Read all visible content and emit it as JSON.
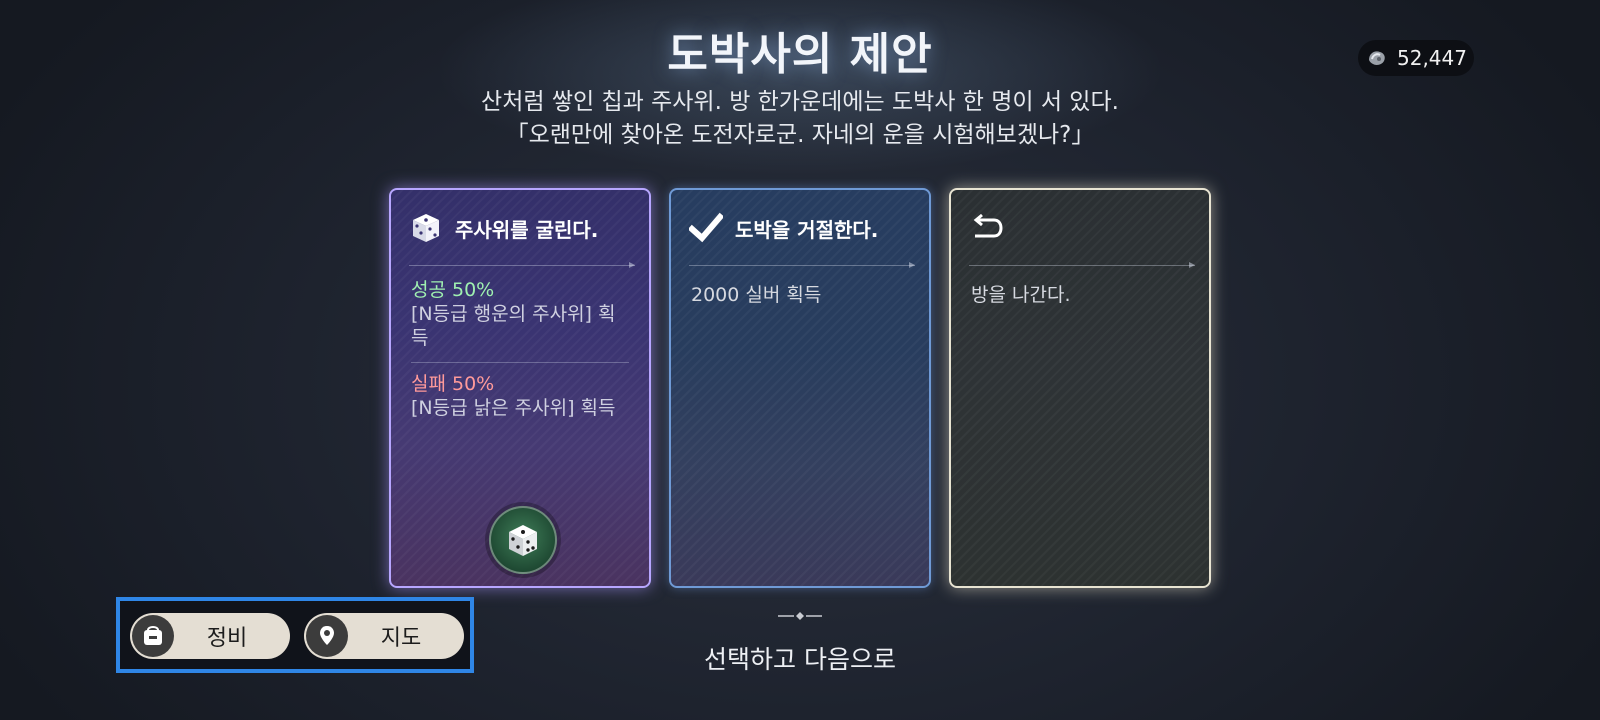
{
  "header": {
    "title": "도박사의 제안",
    "description_line1": "산처럼 쌓인 칩과 주사위. 방 한가운데에는 도박사 한 명이 서 있다.",
    "description_line2": "「오랜만에 찾아온 도전자로군. 자네의 운을 시험해보겠나?」"
  },
  "currency": {
    "icon": "silver-coin-icon",
    "amount": "52,447"
  },
  "cards": {
    "gamble": {
      "title": "주사위를 굴린다.",
      "icon": "dice-icon",
      "success_rate": "성공 50%",
      "success_reward": "[N등급 행운의 주사위] 획득",
      "fail_rate": "실패 50%",
      "fail_reward": "[N등급 낡은 주사위] 획득",
      "action_icon": "dice-roll-icon"
    },
    "refuse": {
      "title": "도박을 거절한다.",
      "icon": "checkmark-icon",
      "reward": "2000 실버 획득"
    },
    "leave": {
      "title": "",
      "icon": "return-arrow-icon",
      "text": "방을 나간다."
    }
  },
  "footer": {
    "next_text": "선택하고 다음으로"
  },
  "bottom_buttons": {
    "maintenance_label": "정비",
    "map_label": "지도"
  },
  "colors": {
    "gamble_border": "#b7a6ff",
    "refuse_border": "#6f9ad6",
    "leave_border": "#e8e4d2",
    "success": "#9ff0b0",
    "fail": "#ff9a9a",
    "panel_highlight": "#2f86e6"
  }
}
